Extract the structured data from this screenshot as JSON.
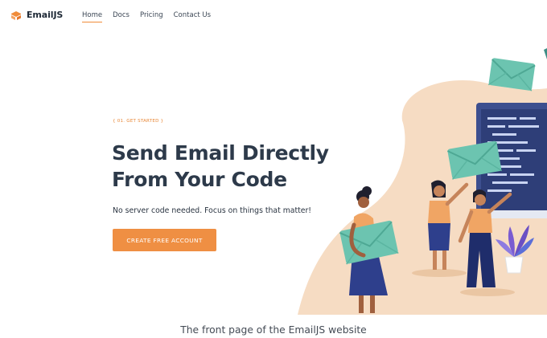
{
  "nav": {
    "logo_text": "EmailJS",
    "links": [
      "Home",
      "Docs",
      "Pricing",
      "Contact Us"
    ]
  },
  "hero": {
    "eyebrow": "{ 01. GET STARTED }",
    "headline_line1": "Send Email Directly",
    "headline_line2": "From Your Code",
    "subtext": "No server code needed. Focus on things that matter!",
    "cta_label": "CREATE FREE ACCOUNT"
  },
  "caption": "The front page of the EmailJS website",
  "colors": {
    "accent": "#ef8f43",
    "blob": "#f6dcc3",
    "envelope": "#6cc4b0",
    "monitor": "#3d4f8f",
    "text_dark": "#2d3a4a"
  },
  "icons": [
    "emailjs-logo-icon",
    "envelope-icon",
    "monitor-icon",
    "plant-icon"
  ]
}
